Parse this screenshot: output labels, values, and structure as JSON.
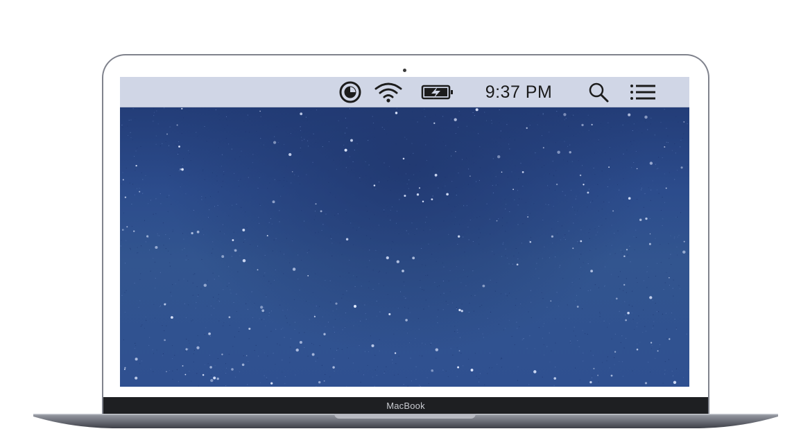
{
  "device": {
    "brand_label": "MacBook"
  },
  "menubar": {
    "icons": [
      {
        "name": "time-machine-icon"
      },
      {
        "name": "wifi-icon"
      },
      {
        "name": "battery-charging-icon"
      },
      {
        "name": "spotlight-search-icon"
      },
      {
        "name": "notification-center-icon"
      }
    ],
    "clock": "9:37 PM"
  },
  "colors": {
    "menubar_bg": "#d0d6e6",
    "wallpaper_blue": "#2f4f8f",
    "bezel": "#1e1f22",
    "frame": "#7f828c"
  }
}
